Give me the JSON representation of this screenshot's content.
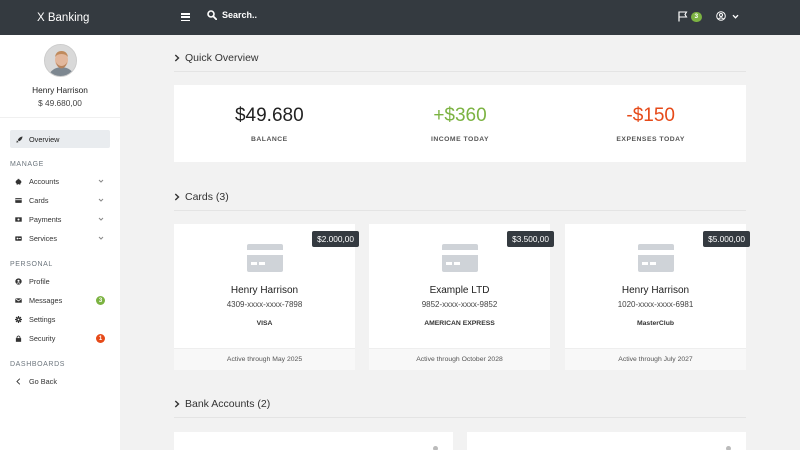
{
  "app": {
    "title": "X Banking"
  },
  "search": {
    "label": "Search.."
  },
  "header": {
    "notification_count": "3"
  },
  "sidebar": {
    "profile_name": "Henry Harrison",
    "profile_balance": "$ 49.680,00",
    "active_item": "Overview",
    "sections": {
      "manage": "MANAGE",
      "personal": "PERSONAL",
      "dashboards": "DASHBOARDS"
    },
    "manage_items": [
      "Accounts",
      "Cards",
      "Payments",
      "Services"
    ],
    "personal_items": [
      "Profile",
      "Messages",
      "Settings",
      "Security"
    ],
    "messages_badge": "3",
    "security_badge": "1",
    "go_back": "Go Back"
  },
  "main": {
    "quick_overview_title": "Quick Overview",
    "overview": [
      {
        "value": "$49.680",
        "label": "BALANCE",
        "color": "#222222"
      },
      {
        "value": "+$360",
        "label": "INCOME TODAY",
        "color": "#7cb342"
      },
      {
        "value": "-$150",
        "label": "EXPENSES TODAY",
        "color": "#e64a19"
      }
    ],
    "cards_title": "Cards (3)",
    "cards": [
      {
        "badge": "$2.000,00",
        "name": "Henry Harrison",
        "number": "4309-xxxx-xxxx-7898",
        "type": "VISA",
        "footer": "Active through May 2025"
      },
      {
        "badge": "$3.500,00",
        "name": "Example LTD",
        "number": "9852-xxxx-xxxx-9852",
        "type": "AMERICAN EXPRESS",
        "footer": "Active through October 2028"
      },
      {
        "badge": "$5.000,00",
        "name": "Henry Harrison",
        "number": "1020-xxxx-xxxx-6981",
        "type": "MasterClub",
        "footer": "Active through July 2027"
      }
    ],
    "bank_accounts_title": "Bank Accounts (2)"
  },
  "colors": {
    "topbar": "#343a40",
    "success": "#7cb342",
    "danger": "#e64a19"
  }
}
